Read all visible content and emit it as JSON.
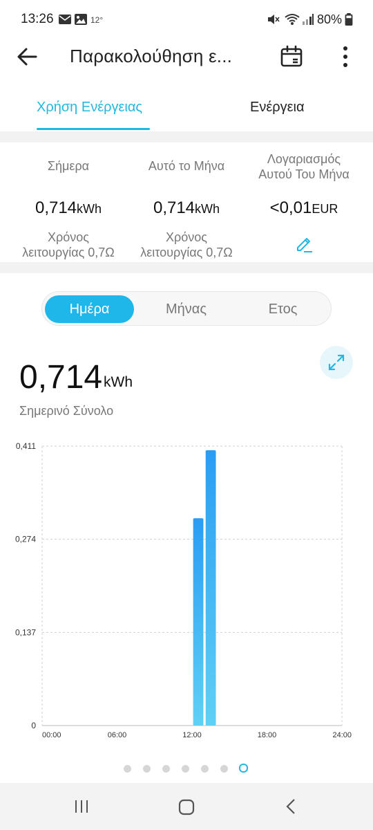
{
  "status_bar": {
    "time": "13:26",
    "temperature": "12°",
    "battery": "80%"
  },
  "header": {
    "title": "Παρακολούθηση ε...",
    "back_icon": "arrow-left-icon",
    "calendar_icon": "calendar-icon",
    "more_icon": "more-vertical-icon"
  },
  "tabs": [
    {
      "label": "Χρήση Ενέργειας",
      "active": true
    },
    {
      "label": "Ενέργεια",
      "active": false
    }
  ],
  "summary": {
    "today": {
      "label": "Σήμερα",
      "value": "0,714",
      "unit": "kWh",
      "sub1": "Χρόνος",
      "sub2": "λειτουργίας 0,7Ω"
    },
    "month": {
      "label": "Αυτό το Μήνα",
      "value": "0,714",
      "unit": "kWh",
      "sub1": "Χρόνος",
      "sub2": "λειτουργίας 0,7Ω"
    },
    "bill": {
      "label1": "Λογαριασμός",
      "label2": "Αυτού Του Μήνα",
      "value": "<0,01",
      "unit": "EUR"
    }
  },
  "segmented": {
    "options": [
      "Ημέρα",
      "Μήνας",
      "Ετος"
    ],
    "selected": "Ημέρα"
  },
  "total": {
    "value": "0,714",
    "unit": "kWh",
    "label": "Σημερινό Σύνολο"
  },
  "chart_data": {
    "type": "bar",
    "x_ticks": [
      "00:00",
      "06:00",
      "12:00",
      "18:00",
      "24:00"
    ],
    "y_ticks": [
      "0",
      "0,137",
      "0,274",
      "0,411"
    ],
    "xlim": [
      0,
      24
    ],
    "ylim": [
      0,
      0.411
    ],
    "bars": [
      {
        "hour": 12,
        "value": 0.305
      },
      {
        "hour": 13,
        "value": 0.405
      }
    ],
    "grid": true
  },
  "pager": {
    "count": 7,
    "active_index": 6
  },
  "colors": {
    "accent": "#22b7e0",
    "bar_top": "#2a9df4",
    "bar_bottom": "#5fd0f5"
  }
}
